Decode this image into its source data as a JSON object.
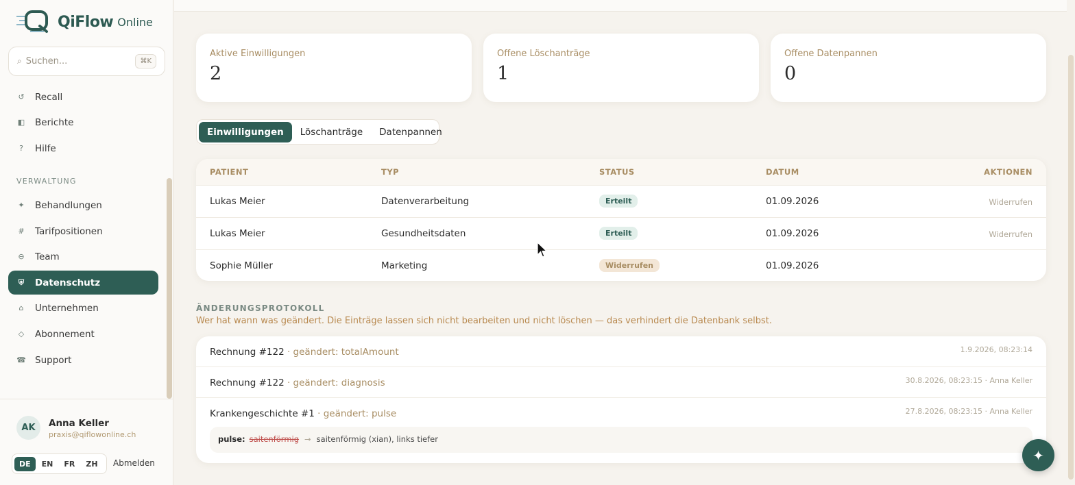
{
  "brand": {
    "name": "QiFlow",
    "suffix": "Online"
  },
  "search": {
    "placeholder": "Suchen...",
    "shortcut": "⌘K"
  },
  "nav": {
    "top_items": [
      {
        "label": "Recall",
        "icon": "refresh-icon"
      },
      {
        "label": "Berichte",
        "icon": "report-icon"
      },
      {
        "label": "Hilfe",
        "icon": "help-icon"
      }
    ],
    "section_label": "VERWALTUNG",
    "admin_items": [
      {
        "label": "Behandlungen",
        "icon": "sparkle-icon"
      },
      {
        "label": "Tarifpositionen",
        "icon": "hash-icon"
      },
      {
        "label": "Team",
        "icon": "team-icon"
      },
      {
        "label": "Datenschutz",
        "icon": "shield-icon",
        "active": true
      },
      {
        "label": "Unternehmen",
        "icon": "home-icon"
      },
      {
        "label": "Abonnement",
        "icon": "diamond-icon"
      },
      {
        "label": "Support",
        "icon": "phone-icon"
      }
    ]
  },
  "user": {
    "initials": "AK",
    "name": "Anna Keller",
    "email": "praxis@qiflowonline.ch"
  },
  "languages": [
    "DE",
    "EN",
    "FR",
    "ZH"
  ],
  "active_language": "DE",
  "logout_label": "Abmelden",
  "kpis": [
    {
      "label": "Aktive Einwilligungen",
      "value": "2"
    },
    {
      "label": "Offene Löschanträge",
      "value": "1"
    },
    {
      "label": "Offene Datenpannen",
      "value": "0"
    }
  ],
  "tabs": [
    "Einwilligungen",
    "Löschanträge",
    "Datenpannen"
  ],
  "active_tab": "Einwilligungen",
  "table": {
    "headers": {
      "patient": "PATIENT",
      "typ": "TYP",
      "status": "STATUS",
      "datum": "DATUM",
      "aktionen": "AKTIONEN"
    },
    "rows": [
      {
        "patient": "Lukas Meier",
        "typ": "Datenverarbeitung",
        "status": "Erteilt",
        "datum": "01.09.2026",
        "action": "Widerrufen"
      },
      {
        "patient": "Lukas Meier",
        "typ": "Gesundheitsdaten",
        "status": "Erteilt",
        "datum": "01.09.2026",
        "action": "Widerrufen"
      },
      {
        "patient": "Sophie Müller",
        "typ": "Marketing",
        "status": "Widerrufen",
        "datum": "01.09.2026",
        "action": ""
      }
    ]
  },
  "log": {
    "title": "ÄNDERUNGSPROTOKOLL",
    "description": "Wer hat wann was geändert. Die Einträge lassen sich nicht bearbeiten und nicht löschen — das verhindert die Datenbank selbst.",
    "entries": [
      {
        "record": "Rechnung #122",
        "change": " · geändert: totalAmount",
        "meta": "1.9.2026, 08:23:14"
      },
      {
        "record": "Rechnung #122",
        "change": " · geändert: diagnosis",
        "meta": "30.8.2026, 08:23:15 · Anna Keller"
      },
      {
        "record": "Krankengeschichte #1",
        "change": " · geändert: pulse",
        "meta": "27.8.2026, 08:23:15 · Anna Keller"
      }
    ],
    "diff": {
      "key": "pulse:",
      "old": "saitenförmig",
      "arrow": "→",
      "new": "saitenförmig (xian), links tiefer"
    }
  },
  "fab_icon": "sparkle-icon",
  "colors": {
    "accent": "#2e5e55",
    "label": "#a88d63",
    "danger": "#c0504d"
  }
}
